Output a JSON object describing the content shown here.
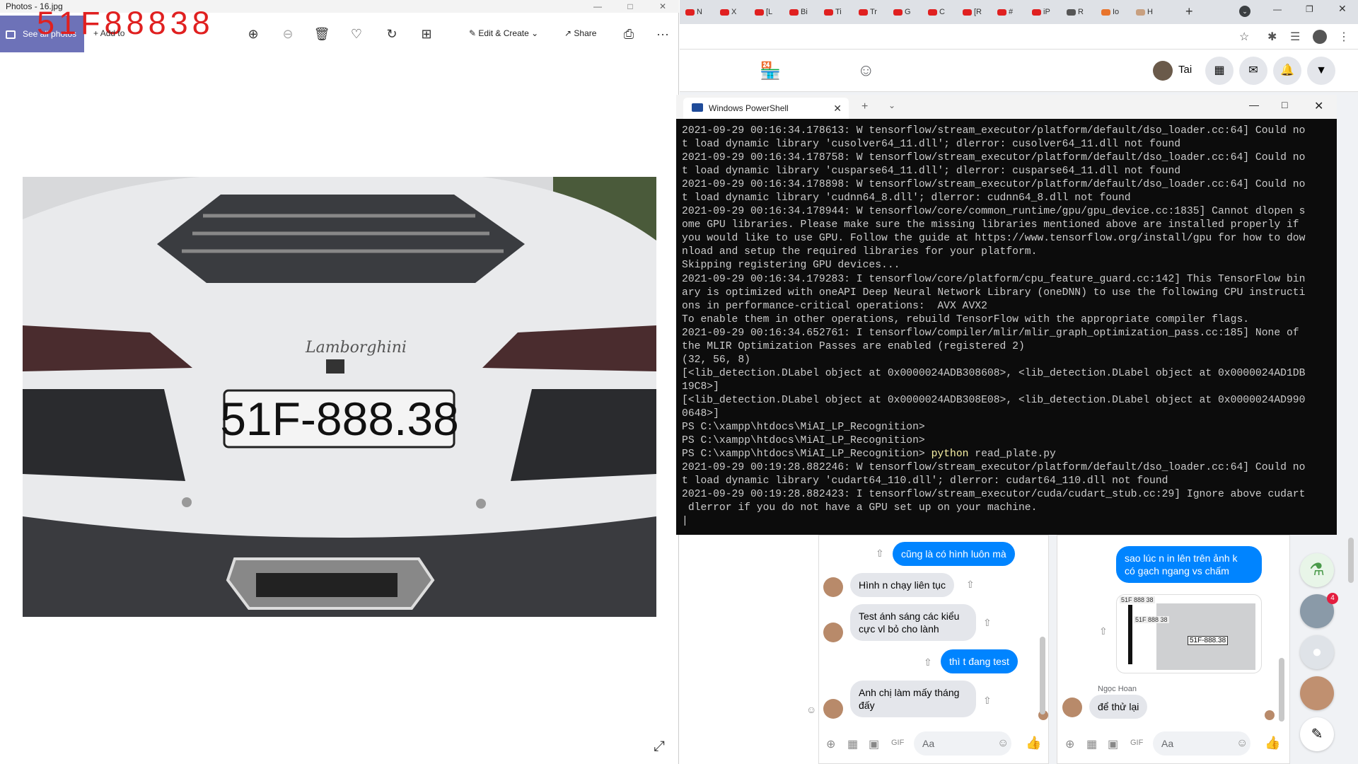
{
  "photos": {
    "title": "Photos - 16.jpg",
    "see_all": "See all photos",
    "add_to": "Add to",
    "plate_overlay": "51F88838",
    "edit_create": "Edit & Create",
    "share": "Share",
    "more": "···",
    "plate_text": "51F-888.38",
    "brand_text": "Lamborghini"
  },
  "browser": {
    "tabs": [
      "N",
      "X",
      "[L",
      "Bi",
      "Ti",
      "Tr",
      "G",
      "C",
      "[R",
      "#",
      "iP",
      "R",
      "Io",
      "H"
    ],
    "user_name": "Tai"
  },
  "powershell": {
    "tab_title": "Windows PowerShell",
    "lines": [
      "2021-09-29 00:16:34.178613: W tensorflow/stream_executor/platform/default/dso_loader.cc:64] Could no",
      "t load dynamic library 'cusolver64_11.dll'; dlerror: cusolver64_11.dll not found",
      "2021-09-29 00:16:34.178758: W tensorflow/stream_executor/platform/default/dso_loader.cc:64] Could no",
      "t load dynamic library 'cusparse64_11.dll'; dlerror: cusparse64_11.dll not found",
      "2021-09-29 00:16:34.178898: W tensorflow/stream_executor/platform/default/dso_loader.cc:64] Could no",
      "t load dynamic library 'cudnn64_8.dll'; dlerror: cudnn64_8.dll not found",
      "2021-09-29 00:16:34.178944: W tensorflow/core/common_runtime/gpu/gpu_device.cc:1835] Cannot dlopen s",
      "ome GPU libraries. Please make sure the missing libraries mentioned above are installed properly if",
      "you would like to use GPU. Follow the guide at https://www.tensorflow.org/install/gpu for how to dow",
      "nload and setup the required libraries for your platform.",
      "Skipping registering GPU devices...",
      "2021-09-29 00:16:34.179283: I tensorflow/core/platform/cpu_feature_guard.cc:142] This TensorFlow bin",
      "ary is optimized with oneAPI Deep Neural Network Library (oneDNN) to use the following CPU instructi",
      "ons in performance-critical operations:  AVX AVX2",
      "To enable them in other operations, rebuild TensorFlow with the appropriate compiler flags.",
      "2021-09-29 00:16:34.652761: I tensorflow/compiler/mlir/mlir_graph_optimization_pass.cc:185] None of",
      "the MLIR Optimization Passes are enabled (registered 2)",
      "(32, 56, 8)",
      "[<lib_detection.DLabel object at 0x0000024ADB308608>, <lib_detection.DLabel object at 0x0000024AD1DB",
      "19C8>]",
      "[<lib_detection.DLabel object at 0x0000024ADB308E08>, <lib_detection.DLabel object at 0x0000024AD990",
      "0648>]",
      "PS C:\\xampp\\htdocs\\MiAI_LP_Recognition>",
      "PS C:\\xampp\\htdocs\\MiAI_LP_Recognition>"
    ],
    "prompt": "PS C:\\xampp\\htdocs\\MiAI_LP_Recognition> ",
    "cmd": "python",
    "cmd_arg": " read_plate.py",
    "after": [
      "2021-09-29 00:19:28.882246: W tensorflow/stream_executor/platform/default/dso_loader.cc:64] Could no",
      "t load dynamic library 'cudart64_110.dll'; dlerror: cudart64_110.dll not found",
      "2021-09-29 00:19:28.882423: I tensorflow/stream_executor/cuda/cudart_stub.cc:29] Ignore above cudart",
      " dlerror if you do not have a GPU set up on your machine."
    ]
  },
  "chat1": {
    "msg1": "cũng là có hình luôn mà",
    "msg2": "Hình n chạy liên tục",
    "msg3a": "Test ánh sáng các kiểu",
    "msg3b": "cực vl bỏ cho lành",
    "msg4": "thì t đang test",
    "msg5a": "Anh chị làm mấy tháng",
    "msg5b": "đấy",
    "aa": "Aa"
  },
  "chat2": {
    "msg1a": "sao lúc n in lên trên ảnh k",
    "msg1b": "có gạch ngang vs chấm",
    "thumb_label1": "51F 888 38",
    "thumb_label2": "51F 888 38",
    "thumb_label3": "51F-888.38",
    "sender": "Ngọc Hoan",
    "msg2": "để thử lại",
    "aa": "Aa"
  },
  "side": {
    "badge": "4"
  },
  "colors": {
    "accent": "#0084ff",
    "photos_accent": "#6d72b8",
    "terminal_bg": "#0c0c0c"
  }
}
